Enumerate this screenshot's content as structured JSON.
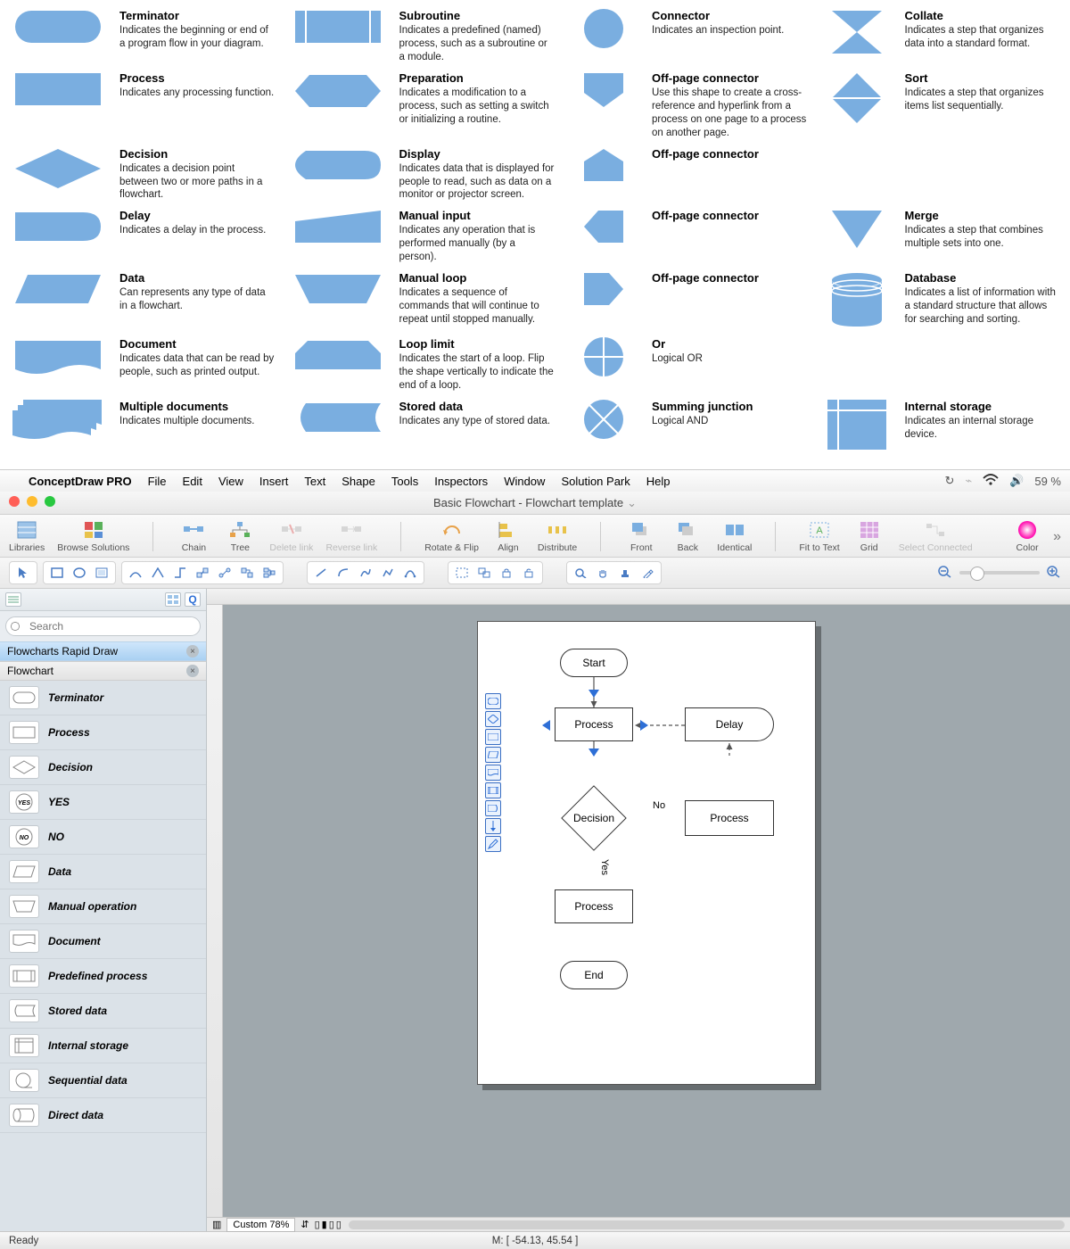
{
  "ref": {
    "terminator": {
      "title": "Terminator",
      "desc": "Indicates the beginning or end of a program flow in your diagram."
    },
    "process": {
      "title": "Process",
      "desc": "Indicates any processing function."
    },
    "decision": {
      "title": "Decision",
      "desc": "Indicates a decision point between two or more paths in a flowchart."
    },
    "delay": {
      "title": "Delay",
      "desc": "Indicates a delay in the process."
    },
    "data": {
      "title": "Data",
      "desc": "Can represents any type of data in a flowchart."
    },
    "document": {
      "title": "Document",
      "desc": "Indicates data that can be read by people, such as printed output."
    },
    "multidoc": {
      "title": "Multiple documents",
      "desc": "Indicates multiple documents."
    },
    "subroutine": {
      "title": "Subroutine",
      "desc": "Indicates a predefined (named) process, such as a subroutine or a module."
    },
    "preparation": {
      "title": "Preparation",
      "desc": "Indicates a modification to a process, such as setting a switch or initializing a routine."
    },
    "display": {
      "title": "Display",
      "desc": "Indicates data that is displayed for people to read, such as data on a monitor or projector screen."
    },
    "manualinput": {
      "title": "Manual input",
      "desc": "Indicates any operation that is performed manually (by a person)."
    },
    "manualloop": {
      "title": "Manual loop",
      "desc": "Indicates a sequence of commands that will continue to repeat until stopped manually."
    },
    "looplimit": {
      "title": "Loop limit",
      "desc": "Indicates the start of a loop. Flip the shape vertically to indicate the end of a loop."
    },
    "storeddata": {
      "title": "Stored data",
      "desc": "Indicates any type of stored data."
    },
    "connector": {
      "title": "Connector",
      "desc": "Indicates an inspection point."
    },
    "offpage": {
      "title": "Off-page connector",
      "desc": "Use this shape to create a cross-reference and hyperlink from a process on one page to a process on another page."
    },
    "offpage2": {
      "title": "Off-page connector",
      "desc": ""
    },
    "offpage3": {
      "title": "Off-page connector",
      "desc": ""
    },
    "offpage4": {
      "title": "Off-page connector",
      "desc": ""
    },
    "or": {
      "title": "Or",
      "desc": "Logical OR"
    },
    "sumjunc": {
      "title": "Summing junction",
      "desc": "Logical AND"
    },
    "collate": {
      "title": "Collate",
      "desc": "Indicates a step that organizes data into a standard format."
    },
    "sort": {
      "title": "Sort",
      "desc": "Indicates a step that organizes items list sequentially."
    },
    "merge": {
      "title": "Merge",
      "desc": "Indicates a step that combines multiple sets into one."
    },
    "database": {
      "title": "Database",
      "desc": "Indicates a list of information with a standard structure that allows for searching and sorting."
    },
    "internal": {
      "title": "Internal storage",
      "desc": "Indicates an internal storage device."
    }
  },
  "menubar": {
    "appname": "ConceptDraw PRO",
    "items": [
      "File",
      "Edit",
      "View",
      "Insert",
      "Text",
      "Shape",
      "Tools",
      "Inspectors",
      "Window",
      "Solution Park",
      "Help"
    ],
    "battery": "59 %"
  },
  "titlebar": {
    "title": "Basic Flowchart - Flowchart template"
  },
  "toolbar": {
    "libraries": "Libraries",
    "browse": "Browse Solutions",
    "chain": "Chain",
    "tree": "Tree",
    "deletelink": "Delete link",
    "reverselink": "Reverse link",
    "rotate": "Rotate & Flip",
    "align": "Align",
    "distribute": "Distribute",
    "front": "Front",
    "back": "Back",
    "identical": "Identical",
    "fit": "Fit to Text",
    "grid": "Grid",
    "selectconn": "Select Connected",
    "color": "Color"
  },
  "search": {
    "placeholder": "Search"
  },
  "libs": {
    "header1": "Flowcharts Rapid Draw",
    "header2": "Flowchart",
    "items": [
      "Terminator",
      "Process",
      "Decision",
      "YES",
      "NO",
      "Data",
      "Manual operation",
      "Document",
      "Predefined process",
      "Stored data",
      "Internal storage",
      "Sequential data",
      "Direct data"
    ]
  },
  "canvas": {
    "start": "Start",
    "process": "Process",
    "delay": "Delay",
    "decision": "Decision",
    "end": "End",
    "no": "No",
    "yes": "Yes"
  },
  "zoombox": "Custom 78%",
  "status": {
    "ready": "Ready",
    "mouse": "M: [ -54.13, 45.54 ]"
  }
}
